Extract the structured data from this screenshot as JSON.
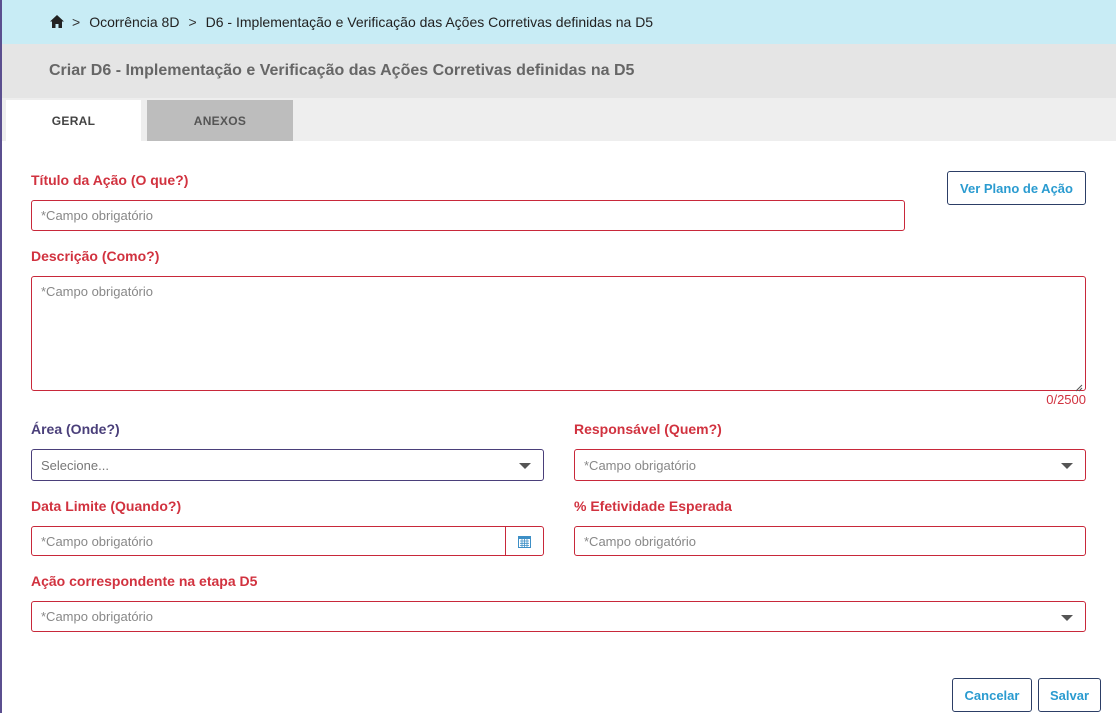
{
  "breadcrumb": {
    "home_icon": "home-icon",
    "separator": ">",
    "items": [
      "Ocorrência 8D",
      "D6 - Implementação e Verificação das Ações Corretivas definidas na D5"
    ]
  },
  "header": {
    "title": "Criar D6 - Implementação e Verificação das Ações Corretivas definidas na D5"
  },
  "tabs": [
    {
      "label": "GERAL",
      "active": true
    },
    {
      "label": "ANEXOS",
      "active": false
    }
  ],
  "form": {
    "titulo": {
      "label": "Título da Ação (O que?)",
      "placeholder": "*Campo obrigatório"
    },
    "ver_plano_button": "Ver Plano de Ação",
    "descricao": {
      "label": "Descrição (Como?)",
      "placeholder": "*Campo obrigatório",
      "counter": "0/2500"
    },
    "area": {
      "label": "Área (Onde?)",
      "value": "Selecione..."
    },
    "responsavel": {
      "label": "Responsável (Quem?)",
      "placeholder": "*Campo obrigatório"
    },
    "data_limite": {
      "label": "Data Limite (Quando?)",
      "placeholder": "*Campo obrigatório",
      "icon": "calendar-icon"
    },
    "efetividade": {
      "label": "% Efetividade Esperada",
      "placeholder": "*Campo obrigatório"
    },
    "acao_d5": {
      "label": "Ação correspondente na etapa D5",
      "placeholder": "*Campo obrigatório"
    }
  },
  "footer": {
    "cancel_label": "Cancelar",
    "save_label": "Salvar"
  },
  "colors": {
    "required": "#d1323f",
    "accent": "#2a9bd0",
    "breadcrumb_bg": "#c8ecf5",
    "optional_label": "#4a3f7a"
  }
}
